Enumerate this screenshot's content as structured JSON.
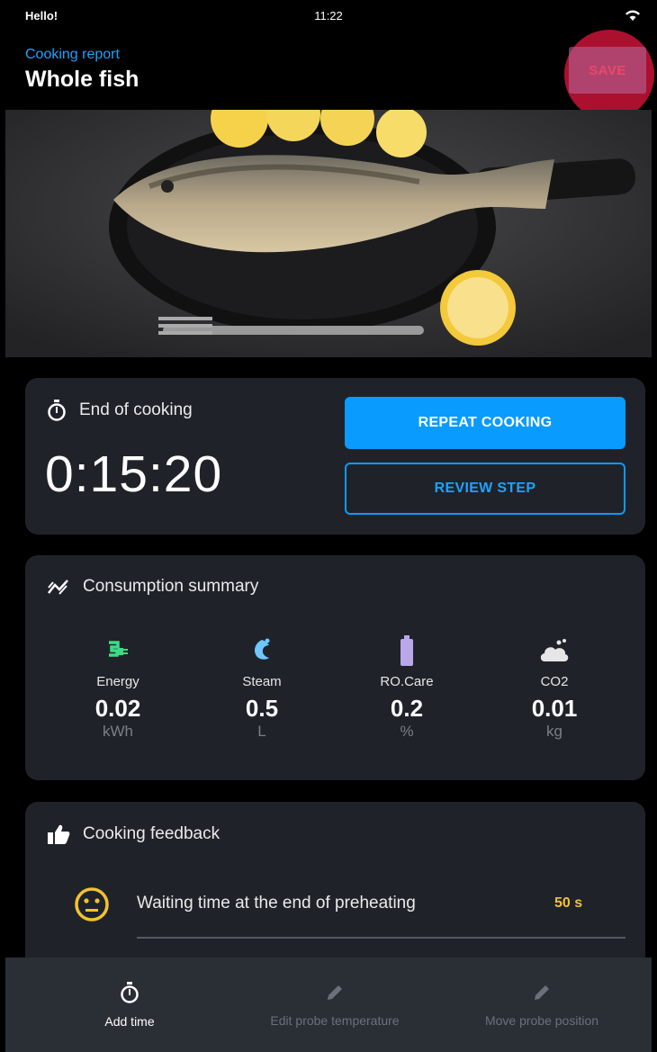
{
  "status_bar": {
    "carrier": "Hello!",
    "time": "11:22"
  },
  "header": {
    "subtitle": "Cooking report",
    "title": "Whole fish",
    "save_label": "SAVE"
  },
  "end_of_cooking": {
    "label": "End of cooking",
    "time": "0:15:20",
    "repeat_label": "REPEAT COOKING",
    "review_label": "REVIEW STEP"
  },
  "consumption": {
    "label": "Consumption summary",
    "items": [
      {
        "label": "Energy",
        "value": "0.02",
        "unit": "kWh",
        "icon": "plug-icon",
        "color": "#3ddc84"
      },
      {
        "label": "Steam",
        "value": "0.5",
        "unit": "L",
        "icon": "steam-icon",
        "color": "#6ec6ff"
      },
      {
        "label": "RO.Care",
        "value": "0.2",
        "unit": "%",
        "icon": "battery-icon",
        "color": "#b9a7e8"
      },
      {
        "label": "CO2",
        "value": "0.01",
        "unit": "kg",
        "icon": "cloud-icon",
        "color": "#e6e6e6"
      }
    ]
  },
  "feedback": {
    "label": "Cooking feedback",
    "items": [
      {
        "text": "Waiting time at the end of preheating",
        "value": "50 s",
        "icon": "smiley-icon"
      }
    ]
  },
  "bottom_bar": {
    "items": [
      {
        "label": "Add time",
        "icon": "timer-icon",
        "enabled": true
      },
      {
        "label": "Edit probe temperature",
        "icon": "pencil-icon",
        "enabled": false
      },
      {
        "label": "Move probe position",
        "icon": "pencil-icon",
        "enabled": false
      }
    ]
  },
  "colors": {
    "accent": "#0a9bff",
    "card": "#1f2329",
    "warning": "#f2c230",
    "save_highlight": "#dc143c"
  }
}
